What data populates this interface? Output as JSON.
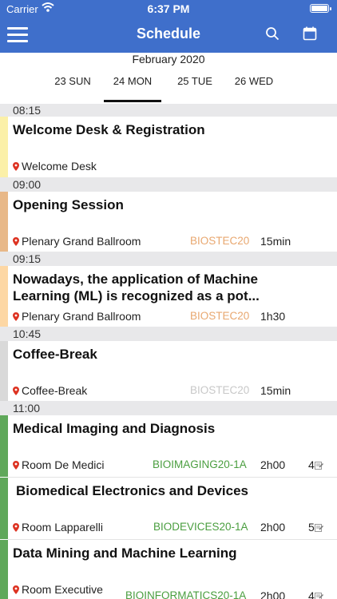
{
  "status": {
    "carrier": "Carrier",
    "time": "6:37 PM"
  },
  "nav": {
    "title": "Schedule",
    "menu_icon": "hamburger-icon",
    "search_icon": "search-icon",
    "calendar_icon": "calendar-icon"
  },
  "date_header": {
    "month": "February 2020",
    "tabs": [
      {
        "label": "23 SUN",
        "active": false
      },
      {
        "label": "24 MON",
        "active": true
      },
      {
        "label": "25 TUE",
        "active": false
      },
      {
        "label": "26 WED",
        "active": false
      }
    ]
  },
  "colors": {
    "nav_bg": "#3f6fcb",
    "code_orange": "#e8a76f",
    "code_green": "#4a9e3f",
    "code_gray": "#c8c8c8"
  },
  "schedule": [
    {
      "time": "08:15",
      "title": "Welcome Desk & Registration",
      "location": "Welcome Desk",
      "code": "",
      "duration": "",
      "count": "",
      "bar_color": "#fbf0a8"
    },
    {
      "time": "09:00",
      "title": "Opening Session",
      "location": "Plenary Grand Ballroom",
      "code": "BIOSTEC20",
      "duration": "15min",
      "count": "",
      "bar_color": "#e8b888"
    },
    {
      "time": "09:15",
      "title_line1": "Nowadays, the application of Machine",
      "title_line2": "Learning (ML) is recognized as a pot...",
      "location": "Plenary Grand Ballroom",
      "code": "BIOSTEC20",
      "duration": "1h30",
      "count": "",
      "bar_color": "#fdd7a4"
    },
    {
      "time": "10:45",
      "title": "Coffee-Break",
      "location": "Coffee-Break",
      "code": "BIOSTEC20",
      "duration": "15min",
      "count": "",
      "bar_color": "#d9d9d9"
    },
    {
      "time": "11:00",
      "title": "Medical Imaging and Diagnosis",
      "location": "Room De Medici",
      "code": "BIOIMAGING20-1A",
      "duration": "2h00",
      "count": "4",
      "bar_color": "#5fa85a"
    },
    {
      "title": "Biomedical Electronics and Devices",
      "location": "Room Lapparelli",
      "code": "BIODEVICES20-1A",
      "duration": "2h00",
      "count": "5",
      "bar_color": "#5fa85a"
    },
    {
      "title": "Data Mining and Machine Learning",
      "location": "Room Executive",
      "code": "BIOINFORMATICS20-1A",
      "duration": "2h00",
      "count": "4",
      "bar_color": "#5fa85a"
    }
  ]
}
